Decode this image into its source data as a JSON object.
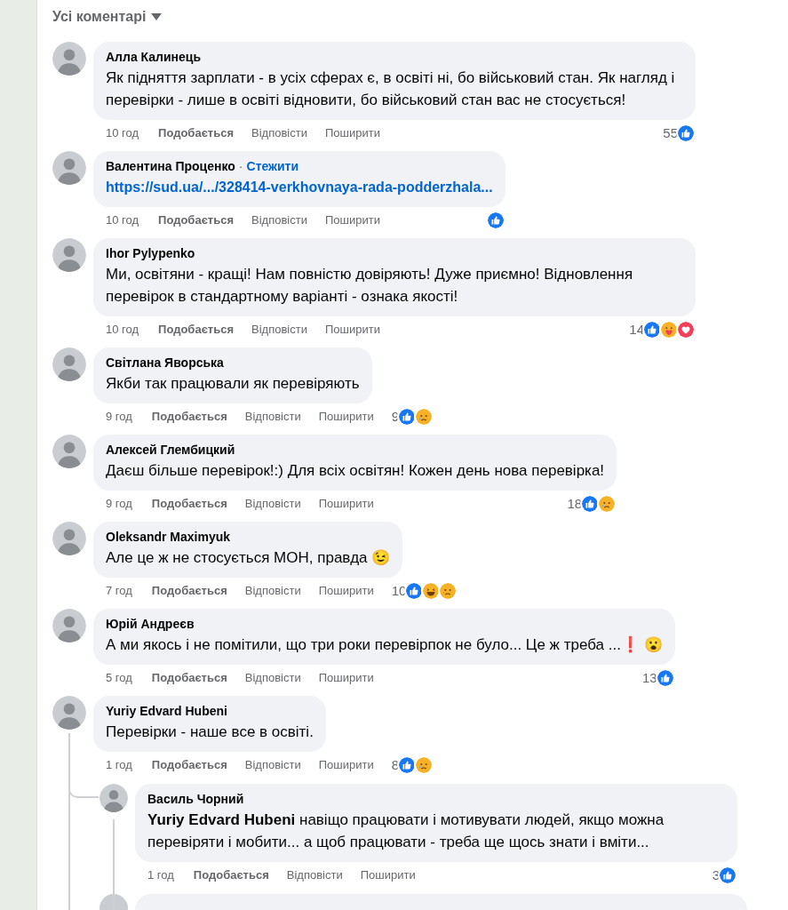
{
  "header": {
    "label": "Усі коментарі"
  },
  "comments": [
    {
      "author": "Алла Калинець",
      "body": "Як підняття зарплати - в усіх сферах є, в освіті ні, бо військовий стан. Як нагляд і перевірки - лише в освіті відновити, бо військовий стан вас не стосується!",
      "time": "10 год",
      "like": "Подобається",
      "reply": "Відповісти",
      "share": "Поширити",
      "count": "55",
      "reactions": [
        {
          "kind": "like"
        }
      ]
    },
    {
      "author": "Валентина Проценко",
      "separator": "·",
      "follow": "Стежити",
      "link": "https://sud.ua/.../328414-verkhovnaya-rada-podderzhala...",
      "time": "10 год",
      "like": "Подобається",
      "reply": "Відповісти",
      "share": "Поширити",
      "reactions": [
        {
          "kind": "like"
        }
      ]
    },
    {
      "author": "Ihor Pylypenko",
      "body": "Ми, освітяни - кращі! Нам повністю довіряють! Дуже приємно! Відновлення перевірок в стандартному варіанті - ознака якості!",
      "time": "10 год",
      "like": "Подобається",
      "reply": "Відповісти",
      "share": "Поширити",
      "count": "14",
      "reactions": [
        {
          "kind": "like"
        },
        {
          "kind": "care"
        },
        {
          "kind": "love"
        }
      ]
    },
    {
      "author": "Світлана Яворська",
      "body": "Якби так працювали як перевіряють",
      "time": "9 год",
      "like": "Подобається",
      "reply": "Відповісти",
      "share": "Поширити",
      "count": "9",
      "reactions": [
        {
          "kind": "like"
        },
        {
          "kind": "sad"
        }
      ]
    },
    {
      "author": "Алексей Глембицкий",
      "body": "Даєш більше перевірок!:) Для всіх освітян! Кожен день нова перевірка!",
      "time": "9 год",
      "like": "Подобається",
      "reply": "Відповісти",
      "share": "Поширити",
      "count": "18",
      "reactions": [
        {
          "kind": "like"
        },
        {
          "kind": "sad"
        }
      ]
    },
    {
      "author": "Oleksandr Maximyuk",
      "body": "Але це ж не стосується МОН, правда 😉",
      "time": "7 год",
      "like": "Подобається",
      "reply": "Відповісти",
      "share": "Поширити",
      "count": "10",
      "reactions": [
        {
          "kind": "like"
        },
        {
          "kind": "haha"
        },
        {
          "kind": "sad"
        }
      ]
    },
    {
      "author": "Юрій Андреєв",
      "body": "А ми якось і не помітили, що три роки перевірпок не було... Це ж треба ...❗ 😮",
      "time": "5 год",
      "like": "Подобається",
      "reply": "Відповісти",
      "share": "Поширити",
      "count": "13",
      "reactions": [
        {
          "kind": "like"
        }
      ]
    },
    {
      "author": "Yuriy Edvard Hubeni",
      "body": "Перевірки - наше все в освіті.",
      "time": "1 год",
      "like": "Подобається",
      "reply": "Відповісти",
      "share": "Поширити",
      "count": "8",
      "reactions": [
        {
          "kind": "like"
        },
        {
          "kind": "sad"
        }
      ],
      "replies": [
        {
          "author": "Василь Чорний",
          "body": "**Yuriy Edvard Hubeni** навіщо працювати і мотивувати людей, якщо можна перевіряти і мобити... а щоб працювати - треба ще щось знати і вміти...",
          "time": "1 год",
          "like": "Подобається",
          "reply": "Відповісти",
          "share": "Поширити",
          "count": "3",
          "reactions": [
            {
              "kind": "like"
            }
          ]
        }
      ]
    }
  ]
}
